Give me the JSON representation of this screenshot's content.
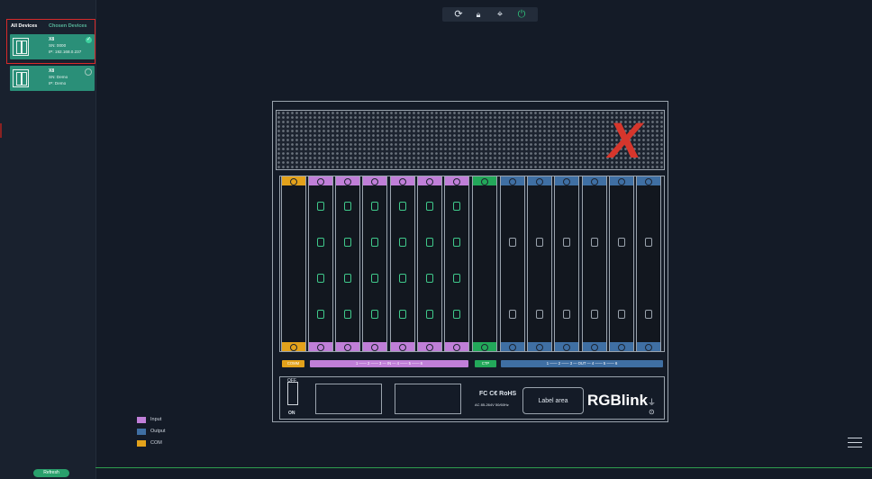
{
  "sidebar": {
    "tabs": [
      {
        "label": "All Devices"
      },
      {
        "label": "Chosen Devices"
      }
    ],
    "devices": [
      {
        "name": "X8",
        "sn": "SN: 0000",
        "ip": "IP: 192.168.0.237",
        "selected": true
      },
      {
        "name": "X8",
        "sn": "SN: Demo",
        "ip": "IP: Demo",
        "selected": false
      }
    ],
    "refresh_label": "Refresh"
  },
  "toolbar": {
    "icons": [
      "refresh-icon",
      "lock-icon",
      "target-icon",
      "power-icon"
    ]
  },
  "chassis": {
    "brand": "RGBlink",
    "label_area": "Label area",
    "switch_off": "OFF",
    "switch_on": "ON",
    "cert": "FC C€ RoHS",
    "power_spec": "AC 85-264V 50/60Hz",
    "bars": {
      "com": "COMM",
      "input": "1 —— 2 —— 3 — IN — 4 —— 5 —— 6",
      "ctrl": "CTP",
      "output": "1 —— 2 —— 3 — OUT — 4 —— 5 —— 6"
    }
  },
  "legend": [
    {
      "label": "Input",
      "color": "#c07fd8"
    },
    {
      "label": "Output",
      "color": "#3f6fa3"
    },
    {
      "label": "COM",
      "color": "#e3a21b"
    }
  ],
  "colors": {
    "accent": "#2a8f78",
    "input": "#c07fd8",
    "output": "#3f6fa3",
    "com": "#e3a21b",
    "control": "#23a85a"
  }
}
